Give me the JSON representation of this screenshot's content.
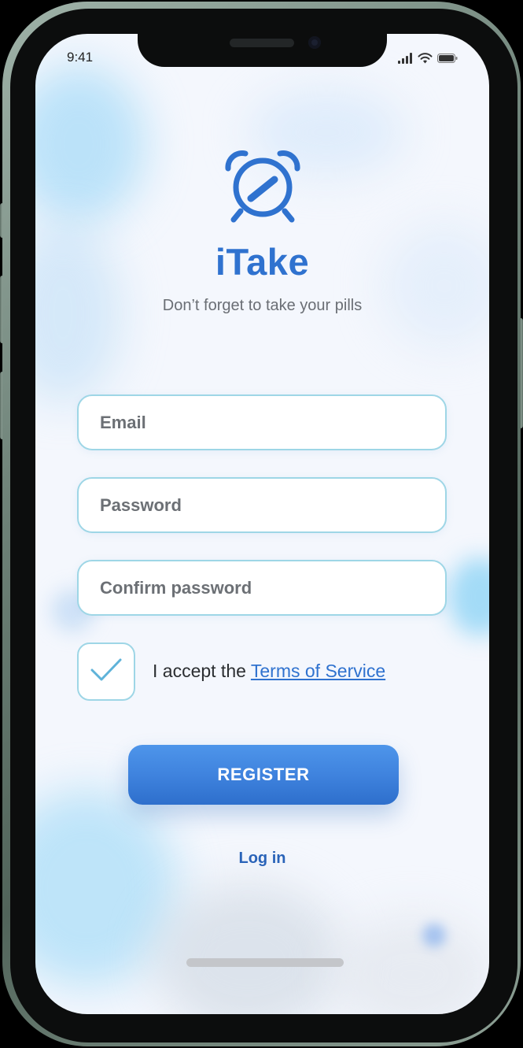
{
  "status_bar": {
    "time": "9:41",
    "icons": [
      "signal-icon",
      "wifi-icon",
      "battery-icon"
    ]
  },
  "app": {
    "name": "iTake",
    "tagline": "Don’t forget to take your pills",
    "logo_icon": "alarm-clock-icon"
  },
  "form": {
    "email_placeholder": "Email",
    "email_value": "",
    "password_placeholder": "Password",
    "password_value": "",
    "confirm_placeholder": "Confirm password",
    "confirm_value": "",
    "terms": {
      "checked": true,
      "prefix": "I accept the ",
      "link_label": "Terms of Service"
    },
    "register_label": "REGISTER",
    "login_label": "Log in"
  },
  "colors": {
    "brand_blue": "#2f72cf",
    "field_border": "#9ed6e6",
    "register_gradient_top": "#4e95ea",
    "register_gradient_bottom": "#2e6fcc",
    "checkmark": "#5fb3d9"
  }
}
